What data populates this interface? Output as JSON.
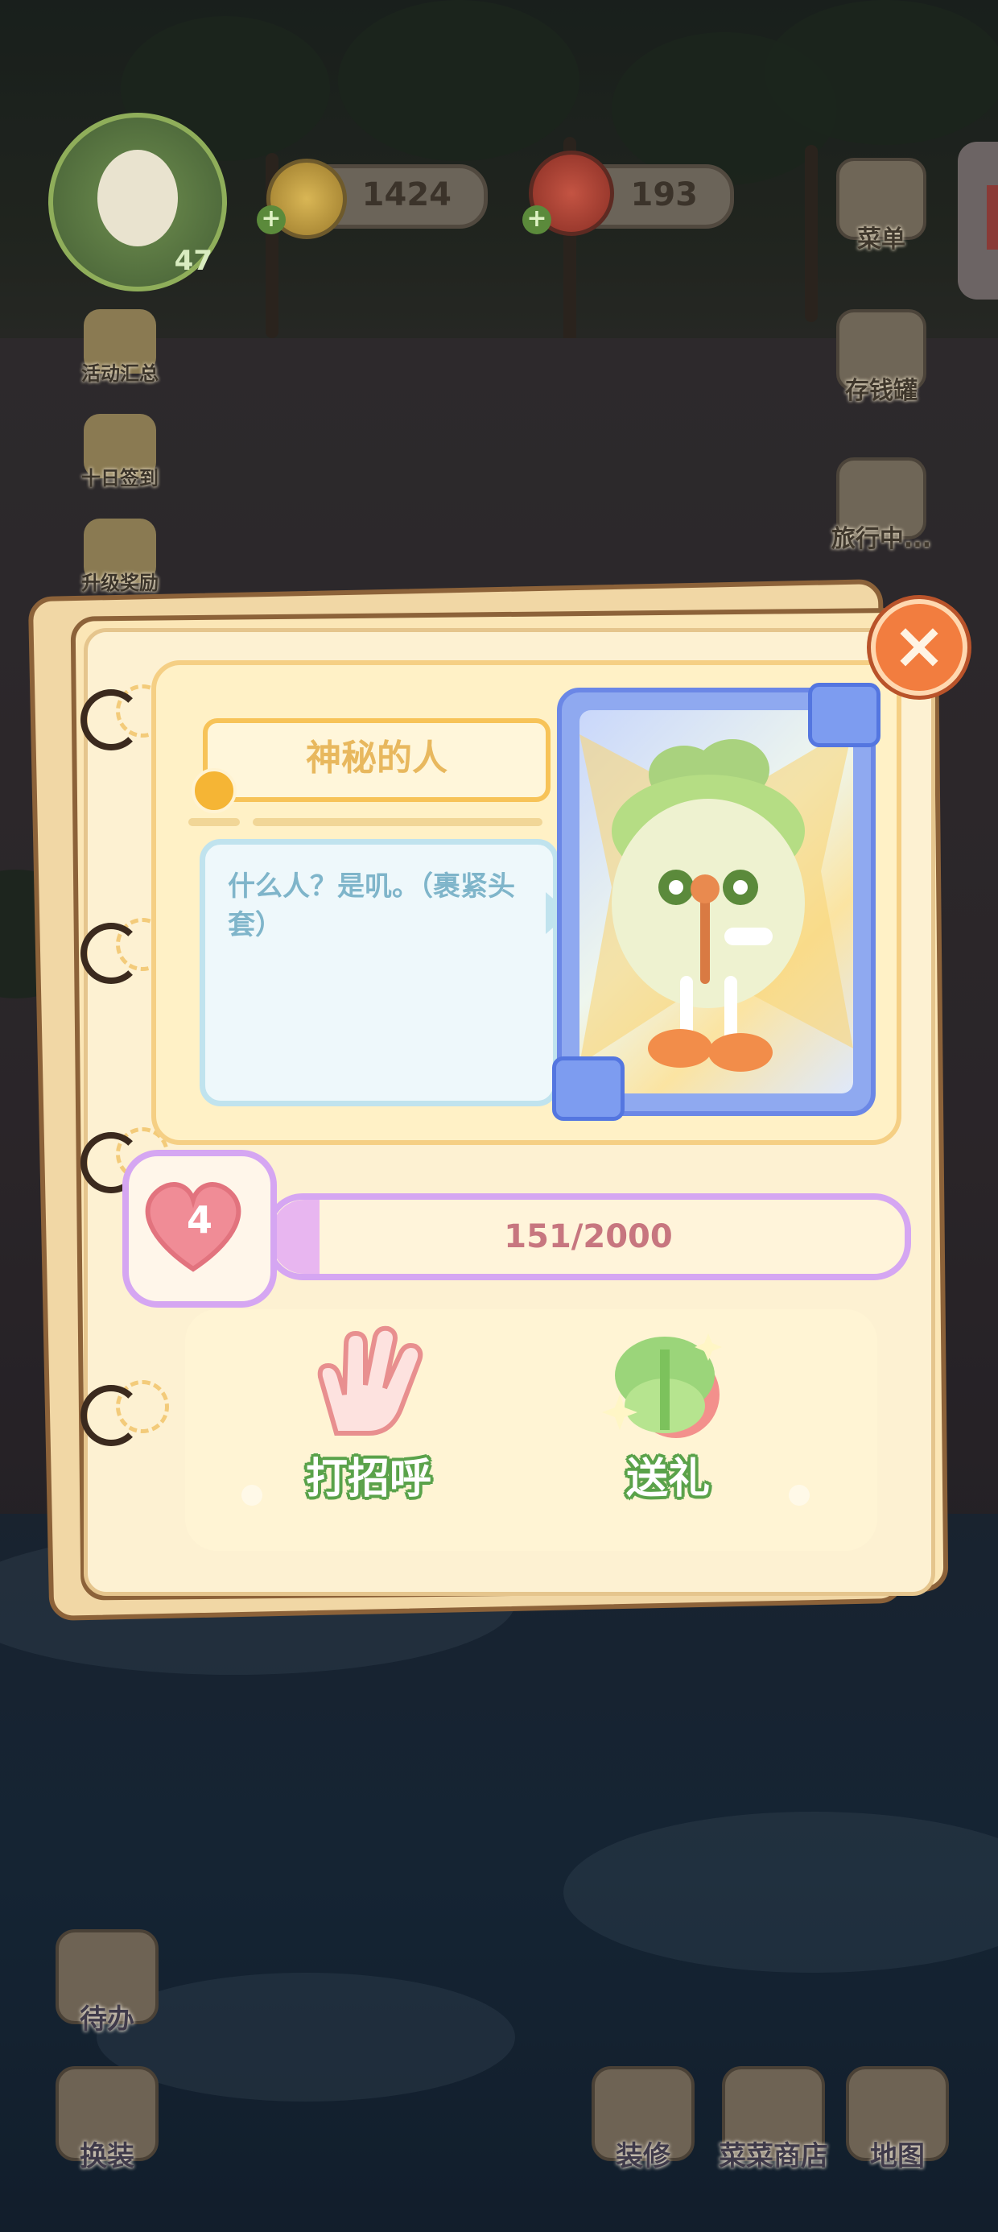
{
  "hud": {
    "level": "47",
    "coins": "1424",
    "food": "193"
  },
  "left_menu": [
    {
      "label": "活动汇总"
    },
    {
      "label": "十日签到"
    },
    {
      "label": "升级奖励"
    }
  ],
  "right_menu": [
    {
      "label": "菜单"
    },
    {
      "label": "存钱罐"
    },
    {
      "label": "旅行中..."
    }
  ],
  "dialog": {
    "character_name": "神秘的人",
    "dialogue": "什么人？是叽。（裹紧头套）",
    "affection_level": "4",
    "affection_progress": "151/2000",
    "affection_fraction": 0.0755,
    "actions": {
      "greet_label": "打招呼",
      "gift_label": "送礼"
    }
  },
  "bottom_left": [
    {
      "label": "待办"
    },
    {
      "label": "换装"
    }
  ],
  "bottom_right": [
    {
      "label": "装修"
    },
    {
      "label": "菜菜商店"
    },
    {
      "label": "地图"
    }
  ],
  "icons": {
    "close": "close-icon",
    "heart": "heart-icon",
    "wave": "waving-hand-icon",
    "gift": "gift-icon"
  }
}
